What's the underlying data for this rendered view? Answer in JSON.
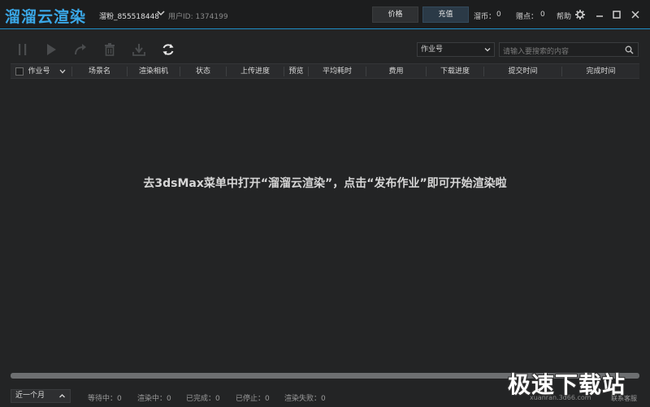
{
  "app": {
    "logo": "溜溜云渲染"
  },
  "user": {
    "name": "溜粉_855518448",
    "id_label": "用户ID: 1374199"
  },
  "header": {
    "price_button": "价格",
    "recharge_button": "充值",
    "coins_label": "溜币：",
    "coins_value": "0",
    "points_label": "赠点：",
    "points_value": "0",
    "help": "帮助"
  },
  "toolbar": {
    "icons": [
      "pause-icon",
      "play-icon",
      "redo-icon",
      "trash-icon",
      "download-icon",
      "refresh-icon"
    ],
    "filter_value": "作业号",
    "search_placeholder": "请输入要搜索的内容"
  },
  "table": {
    "columns": [
      "作业号",
      "场景名",
      "渲染相机",
      "状态",
      "上传进度",
      "预览",
      "平均耗时",
      "费用",
      "下载进度",
      "提交时间",
      "完成时间"
    ]
  },
  "empty_message": "去3dsMax菜单中打开“溜溜云渲染”，点击“发布作业”即可开始渲染啦",
  "statusbar": {
    "period": "近一个月",
    "waiting": "等待中：0",
    "rendering": "渲染中：0",
    "completed": "已完成：0",
    "stopped": "已停止：0",
    "failed": "渲染失败：0",
    "support": "联系客服"
  },
  "watermark": {
    "brand": "极速下载站",
    "site": "xuanran.3d66.com"
  },
  "colors": {
    "accent": "#3aa8e8",
    "background": "#232425",
    "titlebar": "#1c1d1e"
  }
}
